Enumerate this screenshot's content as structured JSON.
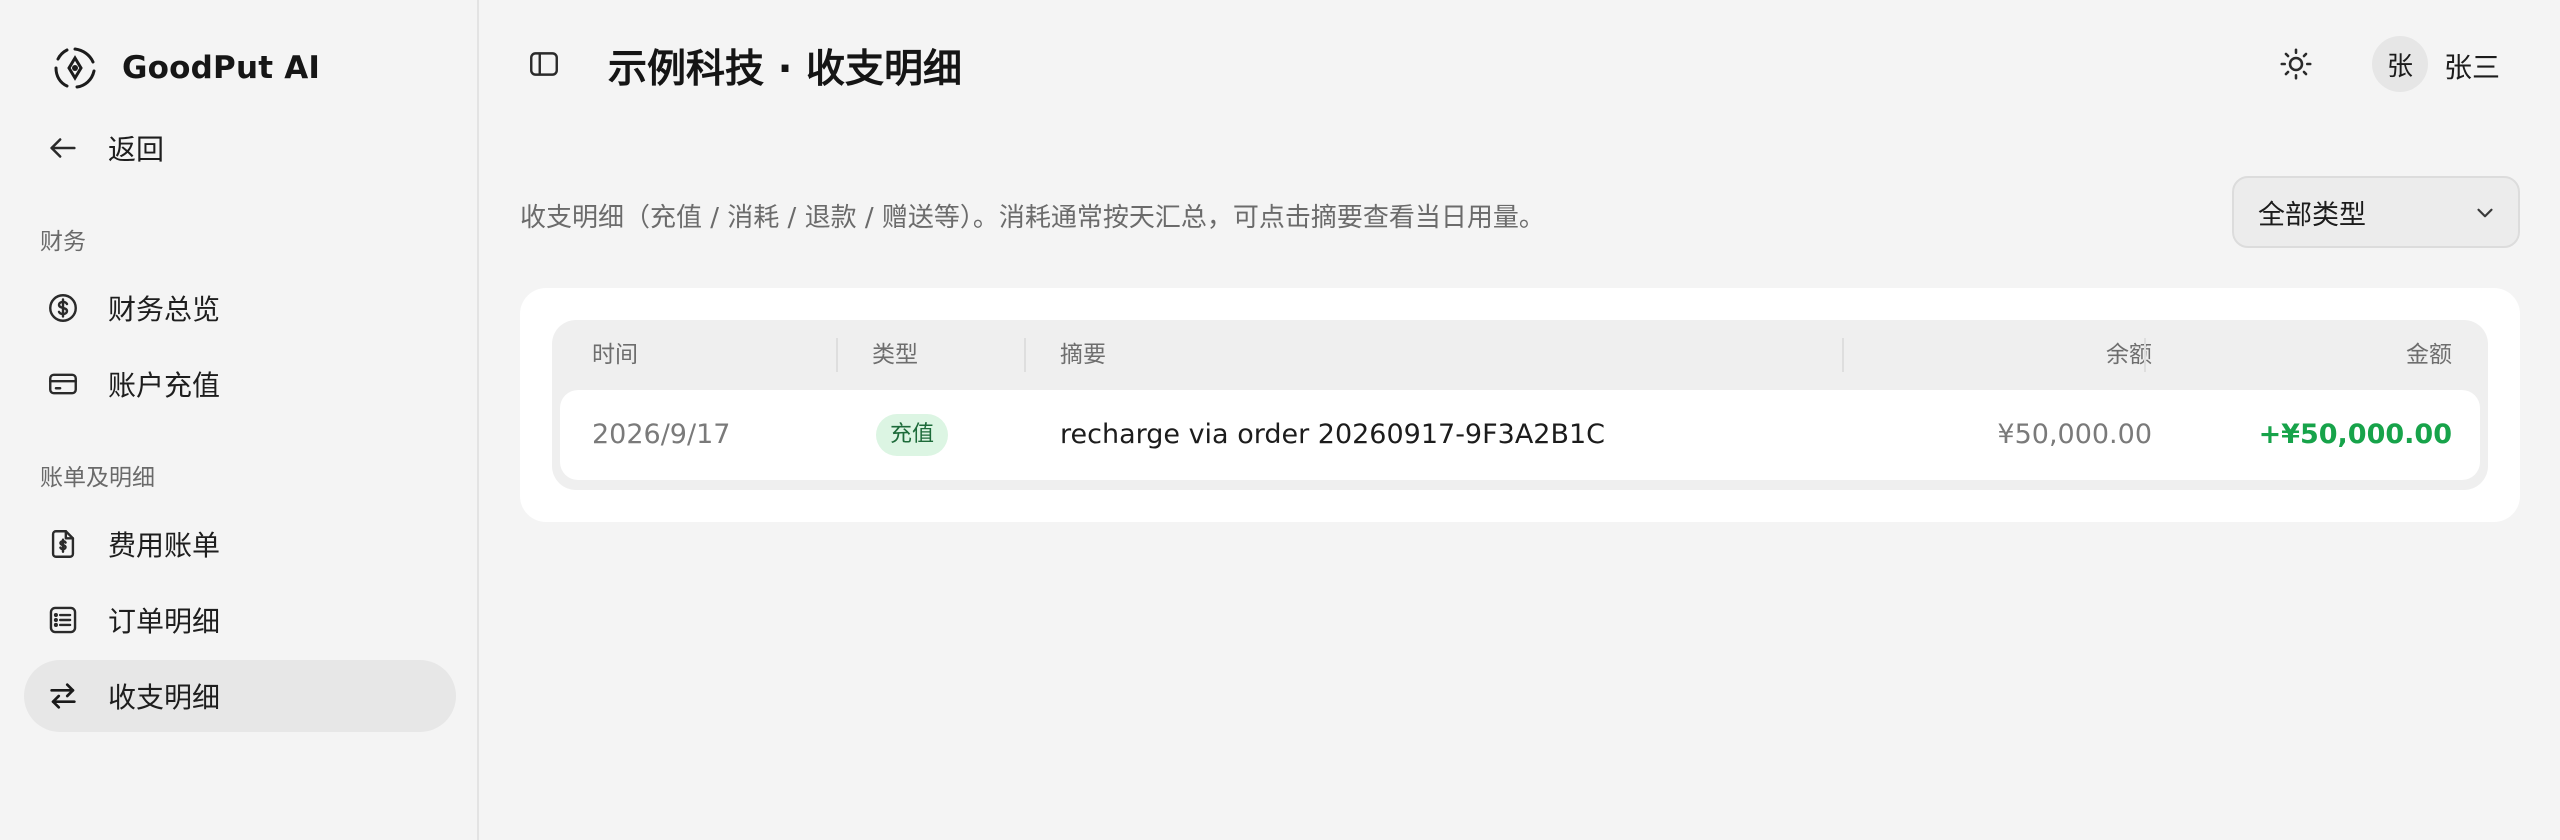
{
  "app": {
    "brand_name": "GoodPut AI"
  },
  "sidebar": {
    "back_label": "返回",
    "sections": [
      {
        "title": "财务",
        "items": [
          {
            "label": "财务总览",
            "icon": "dollar-circle-icon"
          },
          {
            "label": "账户充值",
            "icon": "credit-card-icon"
          }
        ]
      },
      {
        "title": "账单及明细",
        "items": [
          {
            "label": "费用账单",
            "icon": "receipt-dollar-icon"
          },
          {
            "label": "订单明细",
            "icon": "list-icon"
          },
          {
            "label": "收支明细",
            "icon": "arrows-swap-icon",
            "active": true
          }
        ]
      }
    ]
  },
  "header": {
    "title": "示例科技 · 收支明细",
    "user": {
      "avatar_text": "张",
      "name": "张三"
    }
  },
  "main": {
    "description": "收支明细（充值 / 消耗 / 退款 / 赠送等）。消耗通常按天汇总，可点击摘要查看当日用量。",
    "filter": {
      "selected": "全部类型"
    },
    "table": {
      "columns": [
        "时间",
        "类型",
        "摘要",
        "余额",
        "金额"
      ],
      "rows": [
        {
          "time": "2026/9/17",
          "type": "充值",
          "summary": "recharge via order 20260917-9F3A2B1C",
          "balance": "¥50,000.00",
          "amount": "+¥50,000.00"
        }
      ]
    }
  },
  "colors": {
    "positive_amount": "#17a34a",
    "badge_bg": "#dcf5e3",
    "badge_text": "#1d6b3a",
    "active_nav_bg": "#e7e7e7"
  }
}
